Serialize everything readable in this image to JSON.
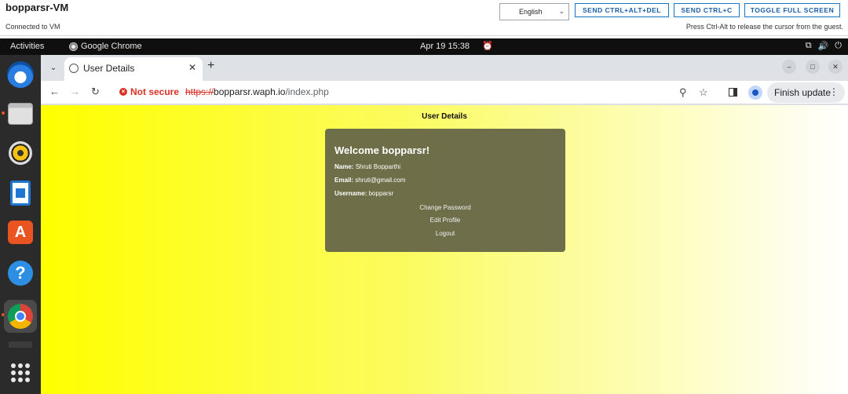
{
  "vm": {
    "title": "bopparsr-VM",
    "status": "Connected to VM",
    "language": "English",
    "buttons": {
      "ctrl_alt_del": "SEND CTRL+ALT+DEL",
      "ctrl_c": "SEND CTRL+C",
      "fullscreen": "TOGGLE FULL SCREEN"
    },
    "hint": "Press Ctrl-Alt to release the cursor from the guest."
  },
  "topbar": {
    "activities": "Activities",
    "app_name": "Google Chrome",
    "clock": "Apr 19  15:38"
  },
  "dock": {
    "items": [
      "thunderbird-icon",
      "files-icon",
      "rhythmbox-icon",
      "libreoffice-writer-icon",
      "app-center-icon",
      "help-icon",
      "chrome-icon",
      "terminal-icon",
      "show-apps-icon"
    ]
  },
  "browser": {
    "tab_title": "User Details",
    "security_label": "Not secure",
    "url_scheme": "https://",
    "url_host": "bopparsr.waph.io",
    "url_path": "/index.php",
    "finish_update": "Finish update"
  },
  "page": {
    "heading": "User Details",
    "welcome": "Welcome bopparsr!",
    "name_label": "Name:",
    "name_value": "Shruti Bopparthi",
    "email_label": "Email:",
    "email_value": "shruti@gmail.com",
    "username_label": "Username:",
    "username_value": "bopparsr",
    "links": {
      "change_password": "Change Password",
      "edit_profile": "Edit Profile",
      "logout": "Logout"
    }
  }
}
